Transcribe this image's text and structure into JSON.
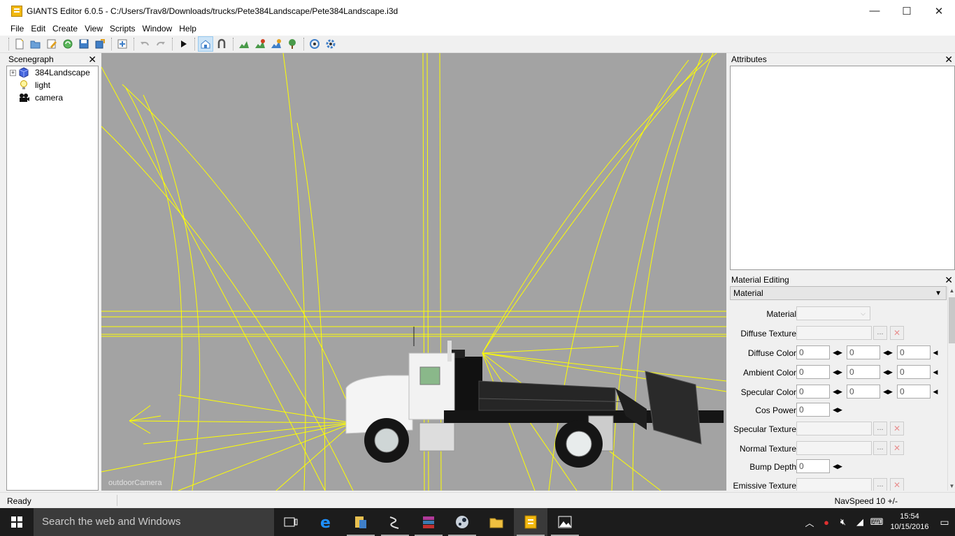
{
  "window": {
    "title": "GIANTS Editor 6.0.5 - C:/Users/Trav8/Downloads/trucks/Pete384Landscape/Pete384Landscape.i3d",
    "minimize": "—",
    "maximize": "☐",
    "close": "✕"
  },
  "menu": [
    "File",
    "Edit",
    "Create",
    "View",
    "Scripts",
    "Window",
    "Help"
  ],
  "scenegraph": {
    "title": "Scenegraph",
    "close": "✕",
    "nodes": [
      {
        "label": "384Landscape",
        "expander": "+"
      },
      {
        "label": "light"
      },
      {
        "label": "camera"
      }
    ]
  },
  "viewport": {
    "camera_label": "outdoorCamera",
    "colors": {
      "background": "#a3a3a3",
      "wire": "#ffff00"
    }
  },
  "attributes": {
    "title": "Attributes",
    "close": "✕"
  },
  "material_editing": {
    "title": "Material Editing",
    "close": "✕",
    "section": "Material",
    "fields": {
      "material": "Material",
      "diffuse_texture": "Diffuse Texture",
      "diffuse_color": "Diffuse Color",
      "ambient_color": "Ambient Color",
      "specular_color": "Specular Color",
      "cos_power": "Cos Power",
      "specular_texture": "Specular Texture",
      "normal_texture": "Normal Texture",
      "bump_depth": "Bump Depth",
      "emissive_texture": "Emissive Texture"
    },
    "values": {
      "diffuse_color": [
        "0",
        "0",
        "0"
      ],
      "ambient_color": [
        "0",
        "0",
        "0"
      ],
      "specular_color": [
        "0",
        "0",
        "0"
      ],
      "cos_power": "0",
      "bump_depth": "0"
    },
    "browse": "...",
    "clear": "✕"
  },
  "status": {
    "left": "Ready",
    "right": "NavSpeed 10 +/-"
  },
  "taskbar": {
    "search_placeholder": "Search the web and Windows",
    "time": "15:54",
    "date": "10/15/2016"
  }
}
